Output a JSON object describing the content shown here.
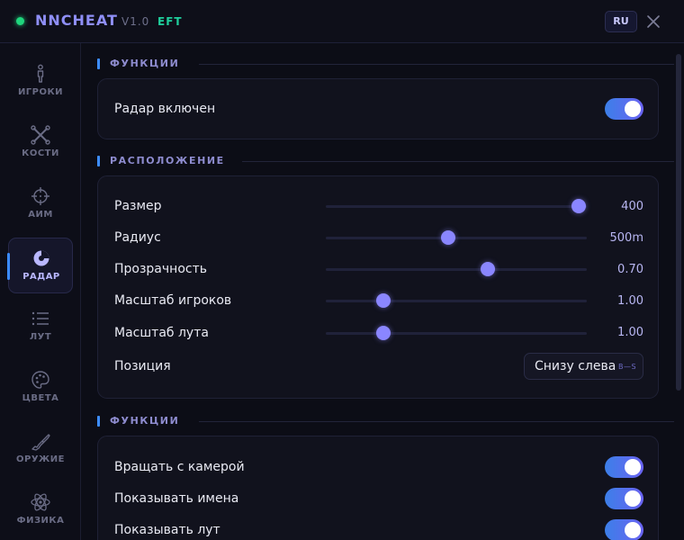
{
  "header": {
    "title": "NNCHEAT",
    "version": "V1.0",
    "game": "EFT",
    "language_button": "RU",
    "status_color": "#1fd67d"
  },
  "sidebar": {
    "items": [
      {
        "label": "ИГРОКИ",
        "icon": "player-icon",
        "active": false
      },
      {
        "label": "КОСТИ",
        "icon": "bones-icon",
        "active": false
      },
      {
        "label": "АИМ",
        "icon": "crosshair-icon",
        "active": false
      },
      {
        "label": "РАДАР",
        "icon": "radar-icon",
        "active": true
      },
      {
        "label": "ЛУТ",
        "icon": "list-icon",
        "active": false
      },
      {
        "label": "ЦВЕТА",
        "icon": "palette-icon",
        "active": false
      },
      {
        "label": "ОРУЖИЕ",
        "icon": "rifle-icon",
        "active": false
      },
      {
        "label": "ФИЗИКА",
        "icon": "atom-icon",
        "active": false
      }
    ]
  },
  "sections": {
    "functions_top": {
      "title": "ФУНКЦИИ",
      "toggles": [
        {
          "label": "Радар включен",
          "on": true
        }
      ]
    },
    "placement": {
      "title": "РАСПОЛОЖЕНИЕ",
      "sliders": [
        {
          "label": "Размер",
          "value": "400",
          "fraction": 0.97
        },
        {
          "label": "Радиус",
          "value": "500m",
          "fraction": 0.47
        },
        {
          "label": "Прозрачность",
          "value": "0.70",
          "fraction": 0.62
        },
        {
          "label": "Масштаб игроков",
          "value": "1.00",
          "fraction": 0.22
        },
        {
          "label": "Масштаб лута",
          "value": "1.00",
          "fraction": 0.22
        }
      ],
      "position": {
        "label": "Позиция",
        "value": "Снизу слева",
        "hint": "B—S"
      }
    },
    "functions_bottom": {
      "title": "ФУНКЦИИ",
      "toggles": [
        {
          "label": "Вращать с камерой",
          "on": true
        },
        {
          "label": "Показывать имена",
          "on": true
        },
        {
          "label": "Показывать лут",
          "on": true
        }
      ]
    }
  },
  "colors": {
    "accent": "#8a86ff",
    "accent_blue": "#3d8dff",
    "game_tag": "#1fcf9d"
  }
}
